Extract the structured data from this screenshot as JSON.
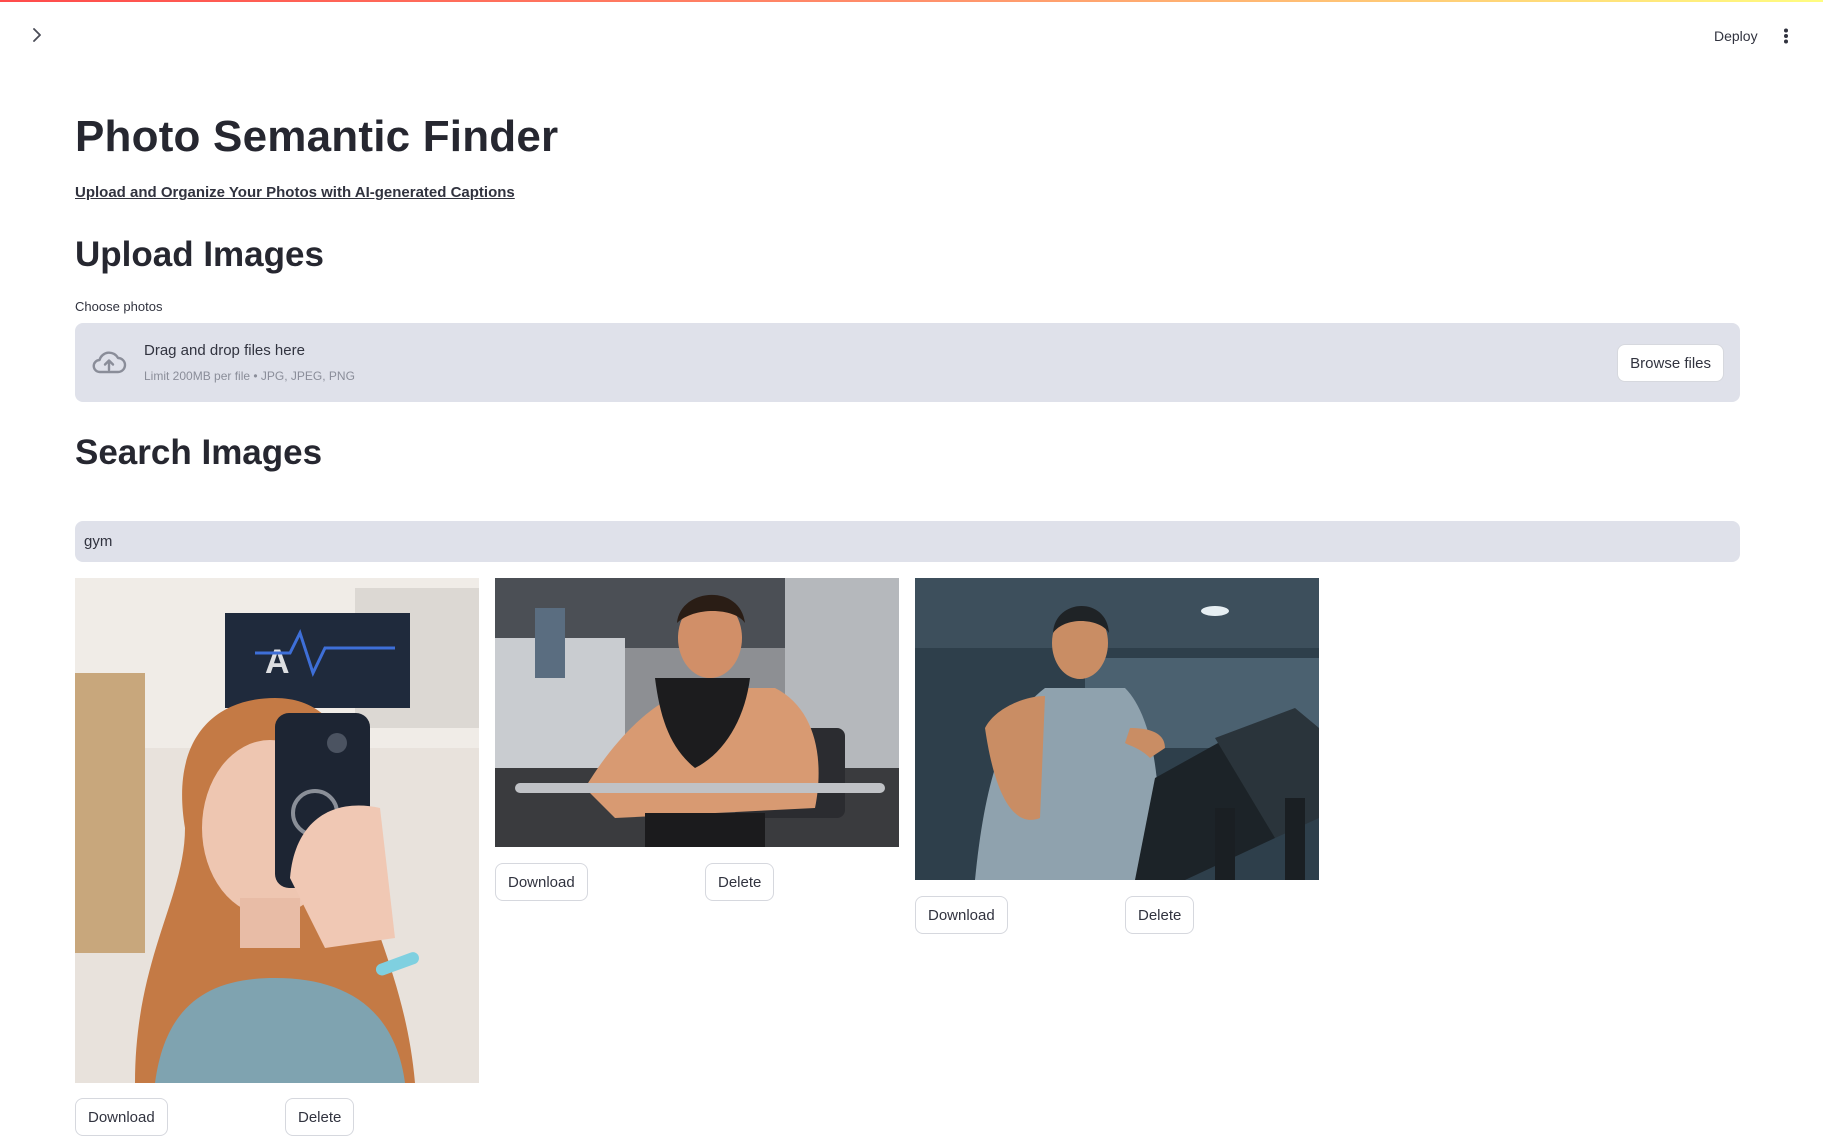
{
  "header": {
    "deploy_label": "Deploy"
  },
  "app": {
    "title": "Photo Semantic Finder",
    "subtitle": "Upload and Organize Your Photos with AI-generated Captions"
  },
  "upload": {
    "heading": "Upload Images",
    "label": "Choose photos",
    "drop_title": "Drag and drop files here",
    "drop_limit": "Limit 200MB per file • JPG, JPEG, PNG",
    "browse_label": "Browse files"
  },
  "search": {
    "heading": "Search Images",
    "query": "gym"
  },
  "results": [
    {
      "download_label": "Download",
      "delete_label": "Delete"
    },
    {
      "download_label": "Download",
      "delete_label": "Delete"
    },
    {
      "download_label": "Download",
      "delete_label": "Delete"
    }
  ],
  "icons": {
    "sidebar_toggle": "chevron-right-icon",
    "menu": "kebab-menu-icon",
    "upload": "cloud-upload-icon"
  },
  "colors": {
    "accent_gradient_start": "#ff4b4b",
    "accent_gradient_end": "#fffd80",
    "input_bg": "#dfe1ea",
    "text": "#31333f"
  }
}
